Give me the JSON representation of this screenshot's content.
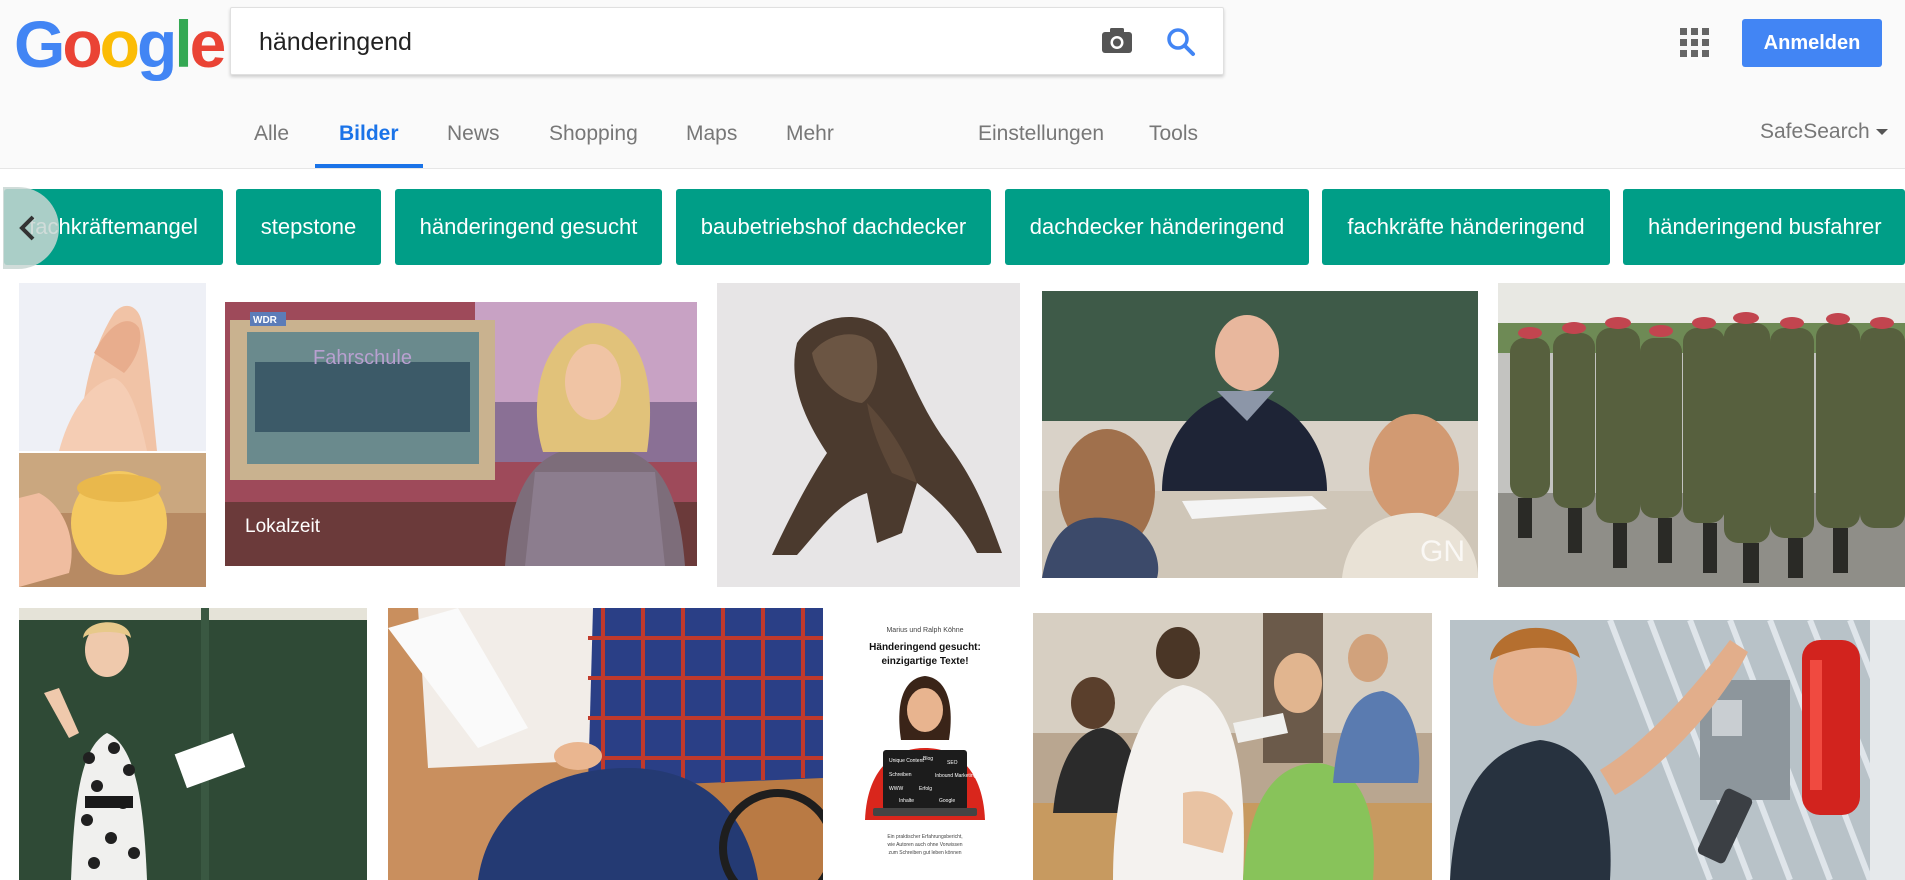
{
  "logo": {
    "letters": [
      "G",
      "o",
      "o",
      "g",
      "l",
      "e"
    ],
    "colors": [
      "#4285f4",
      "#ea4335",
      "#fbbc05",
      "#4285f4",
      "#34a853",
      "#ea4335"
    ]
  },
  "search": {
    "query": "händeringend"
  },
  "header": {
    "signin_label": "Anmelden"
  },
  "tabs": {
    "alle": "Alle",
    "bilder": "Bilder",
    "news": "News",
    "shopping": "Shopping",
    "maps": "Maps",
    "mehr": "Mehr",
    "einstellungen": "Einstellungen",
    "tools": "Tools",
    "safesearch": "SafeSearch"
  },
  "chips": [
    "fachkräftemangel",
    "stepstone",
    "händeringend gesucht",
    "baubetriebshof dachdecker",
    "dachdecker händeringend",
    "fachkräfte händeringend",
    "händeringend busfahrer"
  ],
  "images": {
    "wdr_badge": "WDR",
    "fahrschule_sign": "Fahrschule",
    "lokalzeit": "Lokalzeit",
    "gn_watermark": "GN",
    "book_cover": {
      "author": "Marius und Ralph Köhne",
      "title_line1": "Händeringend gesucht:",
      "title_line2": "einzigartige Texte!",
      "laptop_words": [
        "Unique Content",
        "Blog",
        "SEO",
        "Schreiben",
        "Inbound Marketing",
        "WWW",
        "Erfolg",
        "Inhalte",
        "Google"
      ],
      "footer_line1": "Ein praktischer Erfahrungsbericht,",
      "footer_line2": "wie Autoren auch ohne Vorwissen",
      "footer_line3": "zum Schreiben gut leben können"
    }
  },
  "colors": {
    "accent": "#1a73e8",
    "chip": "#009e87",
    "signin": "#4285f4"
  }
}
